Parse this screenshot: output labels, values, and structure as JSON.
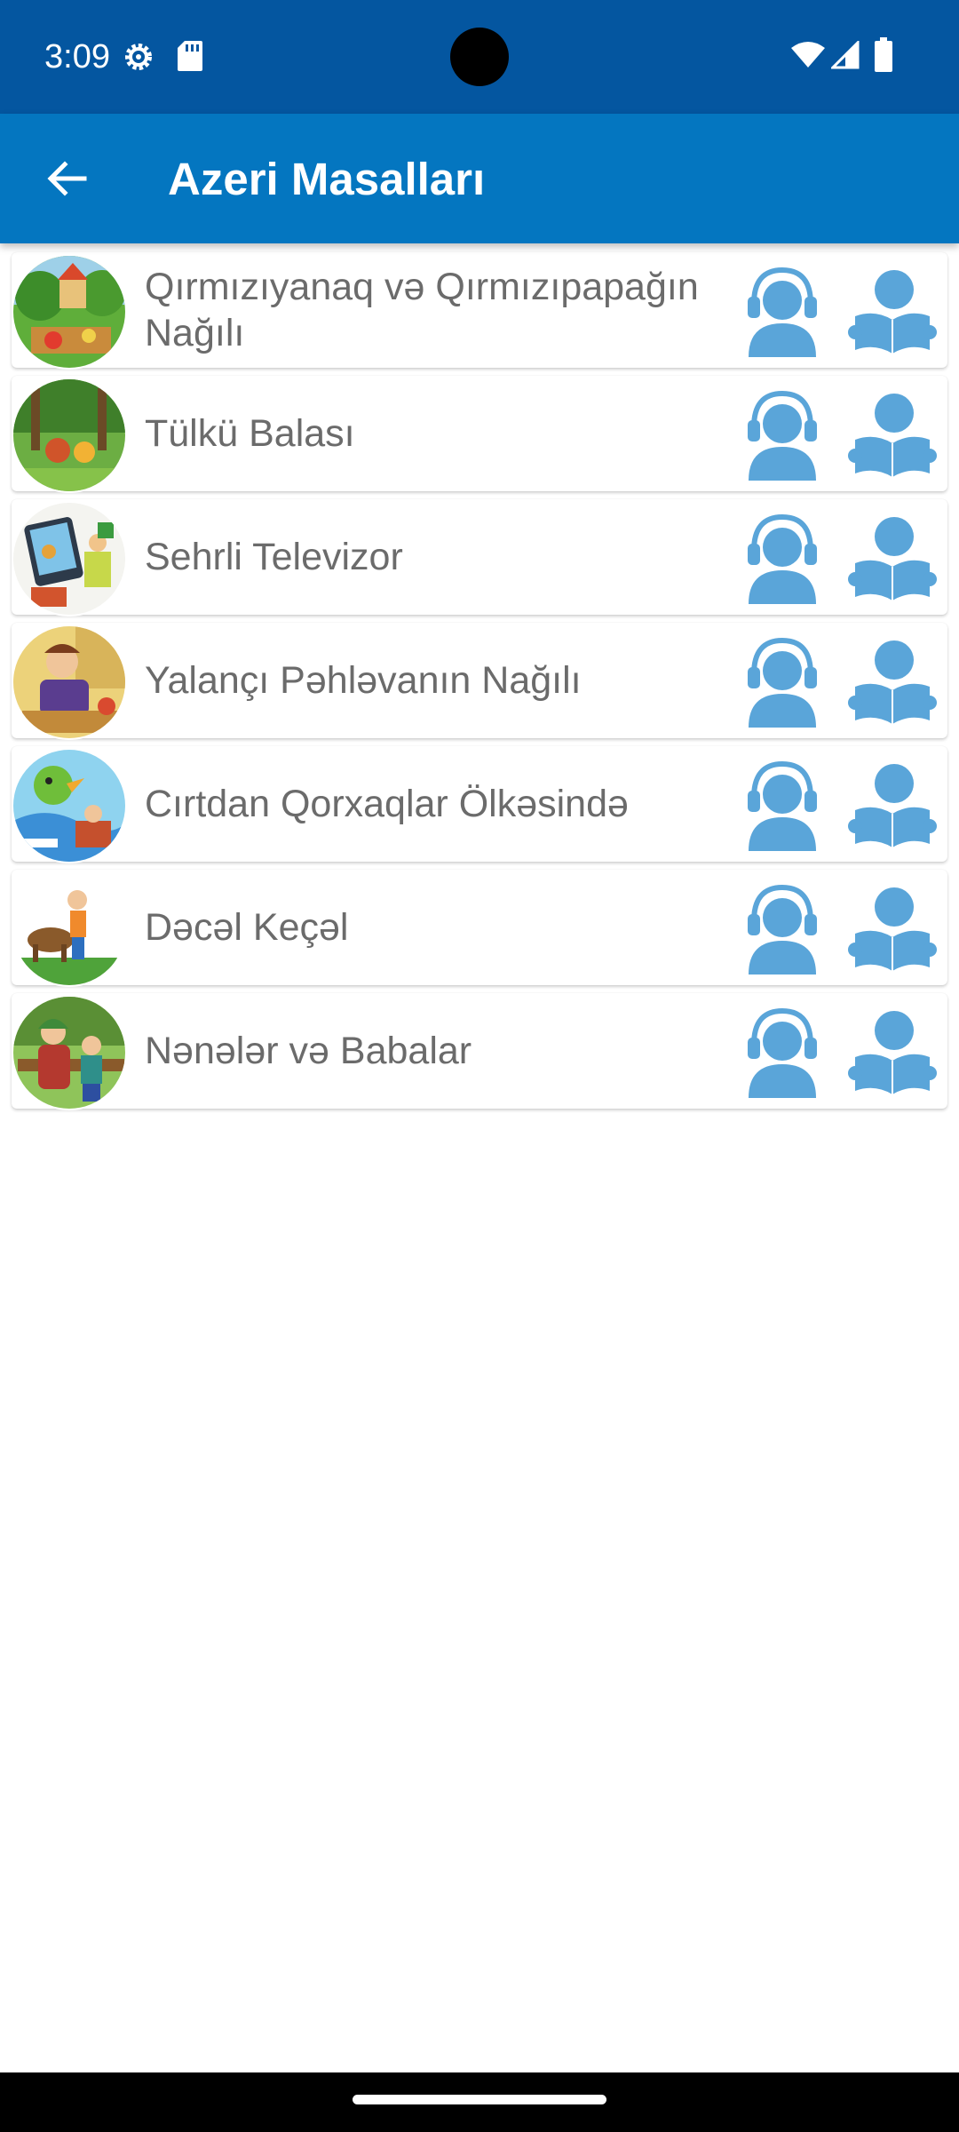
{
  "status_bar": {
    "time": "3:09",
    "icons": [
      "settings-gear-icon",
      "sd-card-icon",
      "wifi-icon",
      "cell-signal-icon",
      "battery-icon"
    ],
    "background": "#0456a0"
  },
  "app_bar": {
    "title": "Azeri Masalları",
    "background": "#0476c0",
    "back_icon": "arrow-back-icon"
  },
  "accent_color": "#5aa5d9",
  "stories": [
    {
      "title": "Qırmızıyanaq və Qırmızıpapağın Nağılı",
      "listen_icon": "headphones-person-icon",
      "read_icon": "reading-person-icon"
    },
    {
      "title": "Tülkü Balası",
      "listen_icon": "headphones-person-icon",
      "read_icon": "reading-person-icon"
    },
    {
      "title": "Sehrli Televizor",
      "listen_icon": "headphones-person-icon",
      "read_icon": "reading-person-icon"
    },
    {
      "title": "Yalançı Pəhləvanın Nağılı",
      "listen_icon": "headphones-person-icon",
      "read_icon": "reading-person-icon"
    },
    {
      "title": "Cırtdan Qorxaqlar Ölkəsində",
      "listen_icon": "headphones-person-icon",
      "read_icon": "reading-person-icon"
    },
    {
      "title": "Dəcəl Keçəl",
      "listen_icon": "headphones-person-icon",
      "read_icon": "reading-person-icon"
    },
    {
      "title": "Nənələr və Babalar",
      "listen_icon": "headphones-person-icon",
      "read_icon": "reading-person-icon"
    }
  ]
}
